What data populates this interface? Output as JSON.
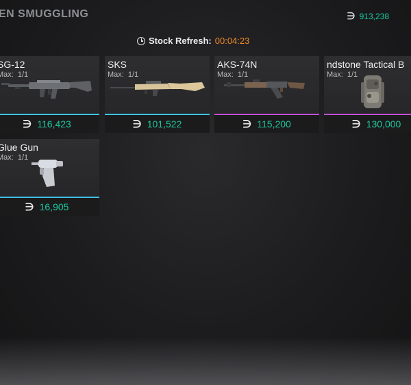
{
  "header": {
    "title": "EN SMUGGLING",
    "balance": "913,238",
    "currency_icon": "∋",
    "refresh_label": "Stock Refresh:",
    "refresh_timer": "00:04:23"
  },
  "colors": {
    "accent_teal": "#1ec8a0",
    "timer_orange": "#f08a24",
    "rarity_blue": "#3fc2e6",
    "rarity_purple": "#c04fd6"
  },
  "items": [
    {
      "name": "SG-12",
      "max_label": "Max:",
      "max_value": "1/1",
      "price": "116,423",
      "rarity_color": "#3fc2e6",
      "icon": "shotgun-icon"
    },
    {
      "name": "SKS",
      "max_label": "Max:",
      "max_value": "1/1",
      "price": "101,522",
      "rarity_color": "#3fc2e6",
      "icon": "rifle-icon"
    },
    {
      "name": "AKS-74N",
      "max_label": "Max:",
      "max_value": "1/1",
      "price": "115,200",
      "rarity_color": "#c04fd6",
      "icon": "assault-rifle-icon"
    },
    {
      "name": "ndstone Tactical B",
      "max_label": "Max:",
      "max_value": "1/1",
      "price": "130,000",
      "rarity_color": "#c04fd6",
      "icon": "backpack-icon"
    },
    {
      "name": "Glue Gun",
      "max_label": "Max:",
      "max_value": "1/1",
      "price": "16,905",
      "rarity_color": "#3fc2e6",
      "icon": "glue-gun-icon"
    }
  ]
}
